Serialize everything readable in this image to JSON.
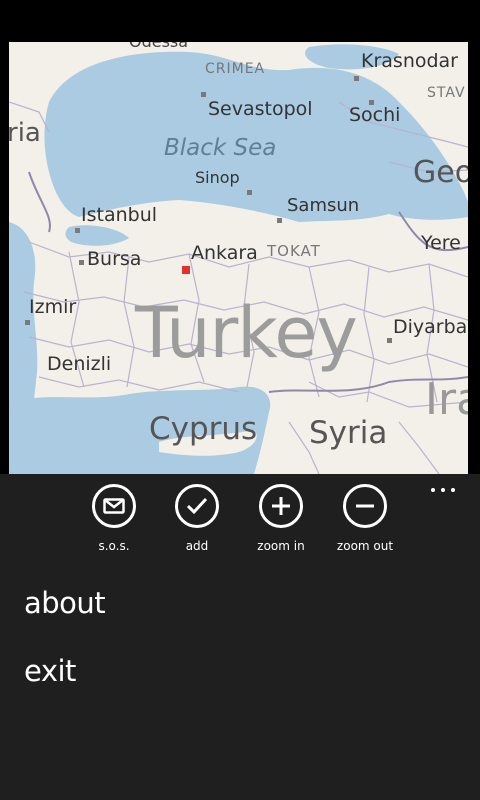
{
  "map": {
    "country_label": "Turkey",
    "sea_label": "Black Sea",
    "partial_top_label": "Odessa",
    "region_labels": {
      "crimea": "CRIMEA",
      "stav": "STAV",
      "tokat": "TOKAT"
    },
    "cities": {
      "krasnodar": "Krasnodar",
      "sevastopol": "Sevastopol",
      "sochi": "Sochi",
      "sinop": "Sinop",
      "samsun": "Samsun",
      "istanbul": "Istanbul",
      "bursa": "Bursa",
      "ankara": "Ankara",
      "izmir": "Izmir",
      "denizli": "Denizli",
      "diyarbakir": "Diyarba",
      "yerevan": "Yere"
    },
    "countries": {
      "cyprus": "Cyprus",
      "syria": "Syria",
      "georgia": "Geo",
      "iraq": "Ira",
      "bulgaria": "ria"
    },
    "colors": {
      "water": "#aacbe2",
      "land": "#f2f0e9",
      "border": "#b9b3cf",
      "marker": "#e5312b"
    }
  },
  "appbar": {
    "buttons": [
      {
        "label": "s.o.s.",
        "icon": "envelope-icon"
      },
      {
        "label": "add",
        "icon": "check-icon"
      },
      {
        "label": "zoom in",
        "icon": "plus-icon"
      },
      {
        "label": "zoom out",
        "icon": "minus-icon"
      }
    ],
    "more_icon": "ellipsis-icon",
    "menu_items": [
      {
        "label": "about"
      },
      {
        "label": "exit"
      }
    ],
    "background": "#1f1f1f"
  }
}
